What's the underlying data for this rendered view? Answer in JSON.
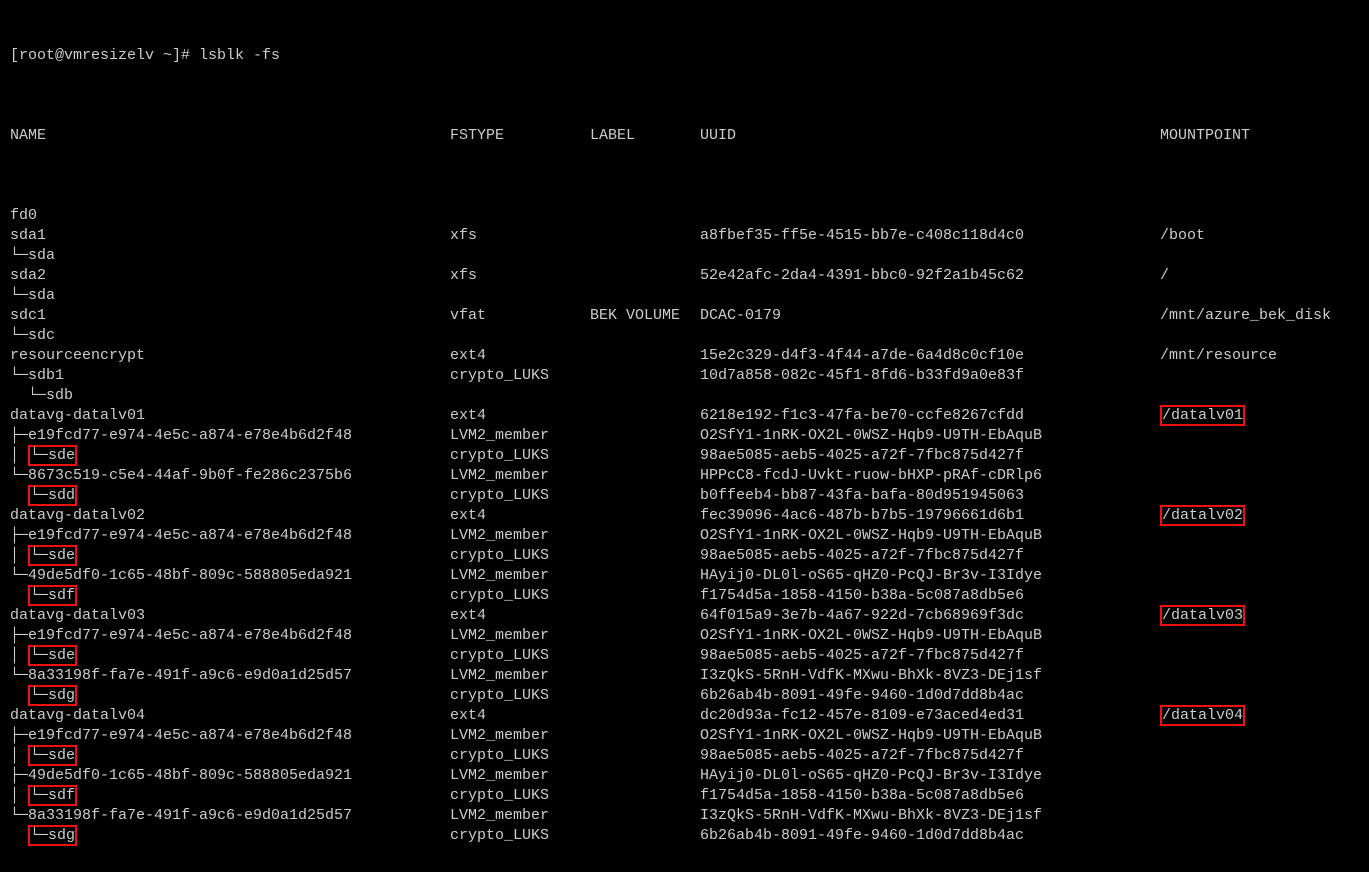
{
  "prompt": "[root@vmresizelv ~]# ",
  "command": "lsblk -fs",
  "headers": {
    "name": "NAME",
    "fstype": "FSTYPE",
    "label": "LABEL",
    "uuid": "UUID",
    "mount": "MOUNTPOINT"
  },
  "rows": [
    {
      "name": "fd0",
      "fstype": "",
      "label": "",
      "uuid": "",
      "mount": "",
      "box_name": false,
      "box_mount": false
    },
    {
      "name": "sda1",
      "fstype": "xfs",
      "label": "",
      "uuid": "a8fbef35-ff5e-4515-bb7e-c408c118d4c0",
      "mount": "/boot",
      "box_name": false,
      "box_mount": false
    },
    {
      "name": "└─sda",
      "fstype": "",
      "label": "",
      "uuid": "",
      "mount": "",
      "box_name": false,
      "box_mount": false
    },
    {
      "name": "sda2",
      "fstype": "xfs",
      "label": "",
      "uuid": "52e42afc-2da4-4391-bbc0-92f2a1b45c62",
      "mount": "/",
      "box_name": false,
      "box_mount": false
    },
    {
      "name": "└─sda",
      "fstype": "",
      "label": "",
      "uuid": "",
      "mount": "",
      "box_name": false,
      "box_mount": false
    },
    {
      "name": "sdc1",
      "fstype": "vfat",
      "label": "BEK VOLUME",
      "uuid": "DCAC-0179",
      "mount": "/mnt/azure_bek_disk",
      "box_name": false,
      "box_mount": false
    },
    {
      "name": "└─sdc",
      "fstype": "",
      "label": "",
      "uuid": "",
      "mount": "",
      "box_name": false,
      "box_mount": false
    },
    {
      "name": "resourceencrypt",
      "fstype": "ext4",
      "label": "",
      "uuid": "15e2c329-d4f3-4f44-a7de-6a4d8c0cf10e",
      "mount": "/mnt/resource",
      "box_name": false,
      "box_mount": false
    },
    {
      "name": "└─sdb1",
      "fstype": "crypto_LUKS",
      "label": "",
      "uuid": "10d7a858-082c-45f1-8fd6-b33fd9a0e83f",
      "mount": "",
      "box_name": false,
      "box_mount": false
    },
    {
      "name": "  └─sdb",
      "fstype": "",
      "label": "",
      "uuid": "",
      "mount": "",
      "box_name": false,
      "box_mount": false
    },
    {
      "name": "datavg-datalv01",
      "fstype": "ext4",
      "label": "",
      "uuid": "6218e192-f1c3-47fa-be70-ccfe8267cfdd",
      "mount": "/datalv01",
      "box_name": false,
      "box_mount": true
    },
    {
      "name": "├─e19fcd77-e974-4e5c-a874-e78e4b6d2f48",
      "fstype": "LVM2_member",
      "label": "",
      "uuid": "O2SfY1-1nRK-OX2L-0WSZ-Hqb9-U9TH-EbAquB",
      "mount": "",
      "box_name": false,
      "box_mount": false
    },
    {
      "name": "│ └─sde",
      "fstype": "crypto_LUKS",
      "label": "",
      "uuid": "98ae5085-aeb5-4025-a72f-7fbc875d427f",
      "mount": "",
      "box_name": true,
      "box_mount": false
    },
    {
      "name": "└─8673c519-c5e4-44af-9b0f-fe286c2375b6",
      "fstype": "LVM2_member",
      "label": "",
      "uuid": "HPPcC8-fcdJ-Uvkt-ruow-bHXP-pRAf-cDRlp6",
      "mount": "",
      "box_name": false,
      "box_mount": false
    },
    {
      "name": "  └─sdd",
      "fstype": "crypto_LUKS",
      "label": "",
      "uuid": "b0ffeeb4-bb87-43fa-bafa-80d951945063",
      "mount": "",
      "box_name": true,
      "box_mount": false
    },
    {
      "name": "datavg-datalv02",
      "fstype": "ext4",
      "label": "",
      "uuid": "fec39096-4ac6-487b-b7b5-19796661d6b1",
      "mount": "/datalv02",
      "box_name": false,
      "box_mount": true
    },
    {
      "name": "├─e19fcd77-e974-4e5c-a874-e78e4b6d2f48",
      "fstype": "LVM2_member",
      "label": "",
      "uuid": "O2SfY1-1nRK-OX2L-0WSZ-Hqb9-U9TH-EbAquB",
      "mount": "",
      "box_name": false,
      "box_mount": false
    },
    {
      "name": "│ └─sde",
      "fstype": "crypto_LUKS",
      "label": "",
      "uuid": "98ae5085-aeb5-4025-a72f-7fbc875d427f",
      "mount": "",
      "box_name": true,
      "box_mount": false
    },
    {
      "name": "└─49de5df0-1c65-48bf-809c-588805eda921",
      "fstype": "LVM2_member",
      "label": "",
      "uuid": "HAyij0-DL0l-oS65-qHZ0-PcQJ-Br3v-I3Idye",
      "mount": "",
      "box_name": false,
      "box_mount": false
    },
    {
      "name": "  └─sdf",
      "fstype": "crypto_LUKS",
      "label": "",
      "uuid": "f1754d5a-1858-4150-b38a-5c087a8db5e6",
      "mount": "",
      "box_name": true,
      "box_mount": false
    },
    {
      "name": "datavg-datalv03",
      "fstype": "ext4",
      "label": "",
      "uuid": "64f015a9-3e7b-4a67-922d-7cb68969f3dc",
      "mount": "/datalv03",
      "box_name": false,
      "box_mount": true
    },
    {
      "name": "├─e19fcd77-e974-4e5c-a874-e78e4b6d2f48",
      "fstype": "LVM2_member",
      "label": "",
      "uuid": "O2SfY1-1nRK-OX2L-0WSZ-Hqb9-U9TH-EbAquB",
      "mount": "",
      "box_name": false,
      "box_mount": false
    },
    {
      "name": "│ └─sde",
      "fstype": "crypto_LUKS",
      "label": "",
      "uuid": "98ae5085-aeb5-4025-a72f-7fbc875d427f",
      "mount": "",
      "box_name": true,
      "box_mount": false
    },
    {
      "name": "└─8a33198f-fa7e-491f-a9c6-e9d0a1d25d57",
      "fstype": "LVM2_member",
      "label": "",
      "uuid": "I3zQkS-5RnH-VdfK-MXwu-BhXk-8VZ3-DEj1sf",
      "mount": "",
      "box_name": false,
      "box_mount": false
    },
    {
      "name": "  └─sdg",
      "fstype": "crypto_LUKS",
      "label": "",
      "uuid": "6b26ab4b-8091-49fe-9460-1d0d7dd8b4ac",
      "mount": "",
      "box_name": true,
      "box_mount": false
    },
    {
      "name": "datavg-datalv04",
      "fstype": "ext4",
      "label": "",
      "uuid": "dc20d93a-fc12-457e-8109-e73aced4ed31",
      "mount": "/datalv04",
      "box_name": false,
      "box_mount": true
    },
    {
      "name": "├─e19fcd77-e974-4e5c-a874-e78e4b6d2f48",
      "fstype": "LVM2_member",
      "label": "",
      "uuid": "O2SfY1-1nRK-OX2L-0WSZ-Hqb9-U9TH-EbAquB",
      "mount": "",
      "box_name": false,
      "box_mount": false
    },
    {
      "name": "│ └─sde",
      "fstype": "crypto_LUKS",
      "label": "",
      "uuid": "98ae5085-aeb5-4025-a72f-7fbc875d427f",
      "mount": "",
      "box_name": true,
      "box_mount": false
    },
    {
      "name": "├─49de5df0-1c65-48bf-809c-588805eda921",
      "fstype": "LVM2_member",
      "label": "",
      "uuid": "HAyij0-DL0l-oS65-qHZ0-PcQJ-Br3v-I3Idye",
      "mount": "",
      "box_name": false,
      "box_mount": false
    },
    {
      "name": "│ └─sdf",
      "fstype": "crypto_LUKS",
      "label": "",
      "uuid": "f1754d5a-1858-4150-b38a-5c087a8db5e6",
      "mount": "",
      "box_name": true,
      "box_mount": false
    },
    {
      "name": "└─8a33198f-fa7e-491f-a9c6-e9d0a1d25d57",
      "fstype": "LVM2_member",
      "label": "",
      "uuid": "I3zQkS-5RnH-VdfK-MXwu-BhXk-8VZ3-DEj1sf",
      "mount": "",
      "box_name": false,
      "box_mount": false
    },
    {
      "name": "  └─sdg",
      "fstype": "crypto_LUKS",
      "label": "",
      "uuid": "6b26ab4b-8091-49fe-9460-1d0d7dd8b4ac",
      "mount": "",
      "box_name": true,
      "box_mount": false
    }
  ]
}
